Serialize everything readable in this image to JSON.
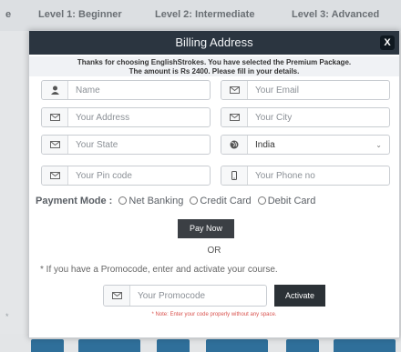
{
  "background": {
    "tabs": [
      "e",
      "Level 1: Beginner",
      "Level 2: Intermediate",
      "Level 3: Advanced"
    ],
    "footnote": "*"
  },
  "modal": {
    "title": "Billing Address",
    "close_label": "X",
    "intro_line1": "Thanks for choosing EnglishStrokes. You have selected the Premium Package.",
    "intro_line2": "The amount is Rs 2400. Please fill in your details.",
    "fields": {
      "name": {
        "placeholder": "Name",
        "icon": "user-icon"
      },
      "email": {
        "placeholder": "Your Email",
        "icon": "envelope-icon"
      },
      "address": {
        "placeholder": "Your Address",
        "icon": "envelope-icon"
      },
      "city": {
        "placeholder": "Your City",
        "icon": "envelope-icon"
      },
      "state": {
        "placeholder": "Your State",
        "icon": "envelope-icon"
      },
      "country": {
        "value": "India",
        "icon": "globe-icon"
      },
      "pincode": {
        "placeholder": "Your Pin code",
        "icon": "envelope-icon"
      },
      "phone": {
        "placeholder": "Your Phone no",
        "icon": "phone-icon"
      }
    },
    "payment": {
      "label": "Payment Mode :",
      "options": [
        "Net Banking",
        "Credit Card",
        "Debit Card"
      ]
    },
    "pay_now_label": "Pay Now",
    "or_label": "OR",
    "promo_hint": "* If you have a Promocode, enter and activate your course.",
    "promo_placeholder": "Your Promocode",
    "activate_label": "Activate",
    "note": "* Note: Enter your code properly without any space."
  },
  "colors": {
    "header_bg": "#2b3540",
    "button_bg": "#3b3f44",
    "note_color": "#d9534f"
  }
}
